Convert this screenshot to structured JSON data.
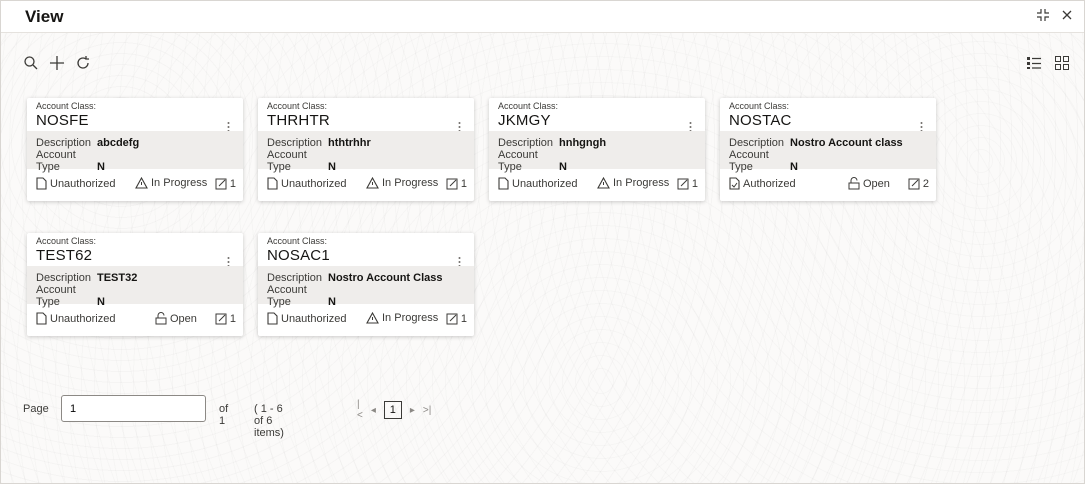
{
  "window": {
    "title": "View"
  },
  "cards": [
    {
      "class_label": "Account Class:",
      "class_value": "NOSFE",
      "desc_label": "Description",
      "desc_value": "abcdefg",
      "type_label": "Account Type",
      "type_value": "N",
      "status": "Unauthorized",
      "progress": "In Progress",
      "version": "1"
    },
    {
      "class_label": "Account Class:",
      "class_value": "THRHTR",
      "desc_label": "Description",
      "desc_value": "hthtrhhr",
      "type_label": "Account Type",
      "type_value": "N",
      "status": "Unauthorized",
      "progress": "In Progress",
      "version": "1"
    },
    {
      "class_label": "Account Class:",
      "class_value": "JKMGY",
      "desc_label": "Description",
      "desc_value": "hnhgngh",
      "type_label": "Account Type",
      "type_value": "N",
      "status": "Unauthorized",
      "progress": "In Progress",
      "version": "1"
    },
    {
      "class_label": "Account Class:",
      "class_value": "NOSTAC",
      "desc_label": "Description",
      "desc_value": "Nostro Account class",
      "type_label": "Account Type",
      "type_value": "N",
      "status": "Authorized",
      "progress": "Open",
      "version": "2"
    },
    {
      "class_label": "Account Class:",
      "class_value": "TEST62",
      "desc_label": "Description",
      "desc_value": "TEST32",
      "type_label": "Account Type",
      "type_value": "N",
      "status": "Unauthorized",
      "progress": "Open",
      "version": "1"
    },
    {
      "class_label": "Account Class:",
      "class_value": "NOSAC1",
      "desc_label": "Description",
      "desc_value": "Nostro Account Class",
      "type_label": "Account Type",
      "type_value": "N",
      "status": "Unauthorized",
      "progress": "In Progress",
      "version": "1"
    }
  ],
  "pager": {
    "page_label": "Page",
    "page_value": "1",
    "of_label": "of 1",
    "items_label": "( 1 - 6 of 6 items)",
    "current": "1"
  },
  "icons": {
    "header": [
      "minimize-icon",
      "close-icon"
    ],
    "toolbar": [
      "search-icon",
      "add-icon",
      "refresh-icon"
    ],
    "views": [
      "list-view-icon",
      "grid-view-icon"
    ]
  },
  "colors": {
    "text": "#161513",
    "muted": "#3b3a37",
    "card_body": "#efedeb",
    "background": "#fbfaf9"
  }
}
